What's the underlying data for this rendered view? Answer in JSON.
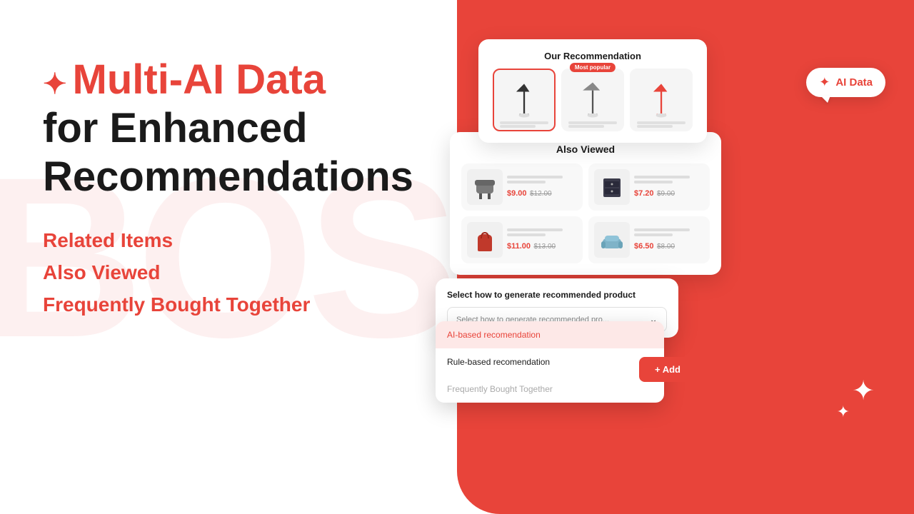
{
  "page": {
    "bg_left_color": "#ffffff",
    "bg_right_color": "#e8443a"
  },
  "hero": {
    "star_symbol": "✦",
    "title_red": "Multi-AI Data",
    "title_black_1": "for Enhanced",
    "title_black_2": "Recommendations",
    "features": [
      "Related Items",
      "Also Viewed",
      "Frequently Bought Together"
    ]
  },
  "rec_card": {
    "title": "Our Recommendation",
    "badge": "Most popular",
    "items": [
      {
        "id": "lamp1",
        "active": true
      },
      {
        "id": "lamp2",
        "active": false
      },
      {
        "id": "lamp3",
        "active": false
      }
    ]
  },
  "also_viewed": {
    "title": "Also Viewed",
    "products": [
      {
        "price_sale": "$9.00",
        "price_orig": "$12.00"
      },
      {
        "price_sale": "$7.20",
        "price_orig": "$9.00"
      },
      {
        "price_sale": "$11.00",
        "price_orig": "$13.00"
      },
      {
        "price_sale": "$6.50",
        "price_orig": "$8.00"
      }
    ]
  },
  "dropdown": {
    "label": "Select how to generate recommended product",
    "placeholder": "Select how to generate recommended pro...",
    "options": [
      {
        "label": "AI-based recomendation",
        "selected": true
      },
      {
        "label": "Rule-based recomendation",
        "selected": false
      },
      {
        "label": "Frequently Bought Together",
        "selected": false,
        "muted": true
      }
    ]
  },
  "add_button": {
    "label": "+ Add"
  },
  "ai_bubble": {
    "star": "✦",
    "text": "AI Data"
  },
  "deco": {
    "star_large": "✦",
    "star_small": "✦"
  }
}
